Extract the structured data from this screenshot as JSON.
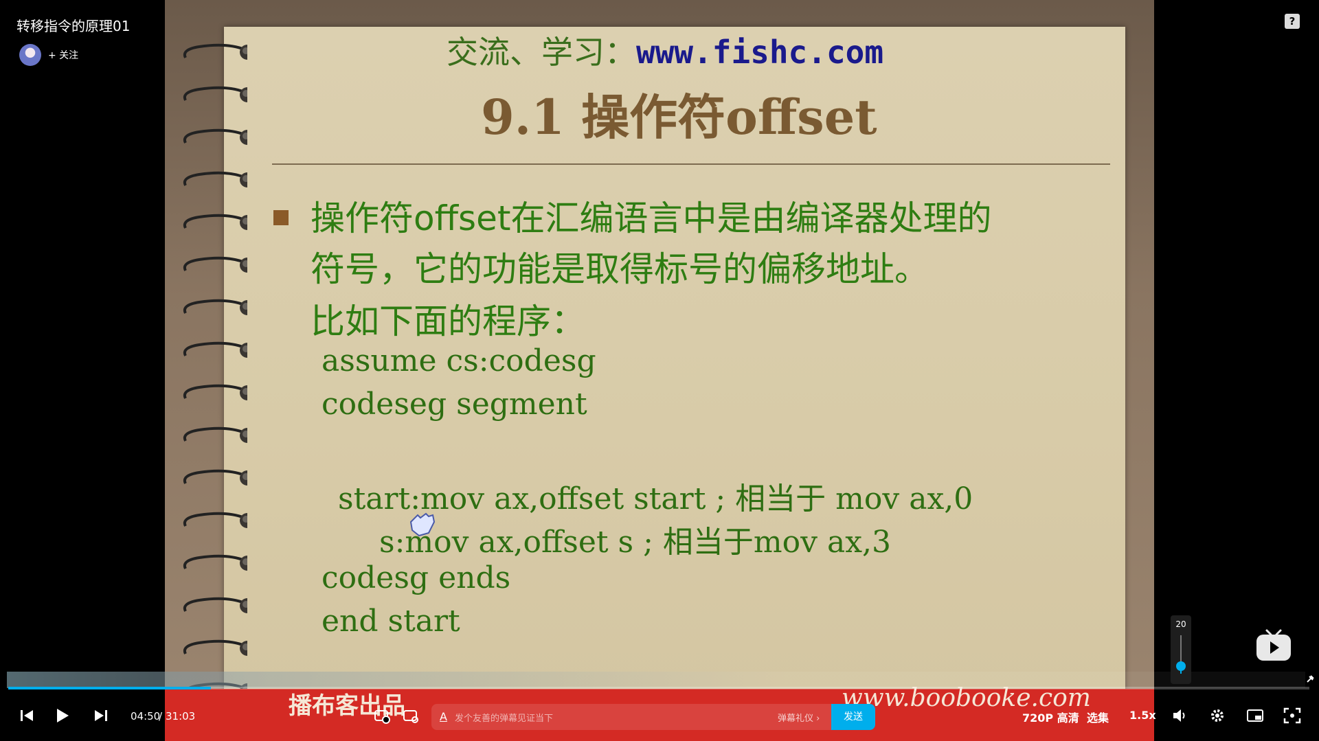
{
  "header": {
    "title": "转移指令的原理01",
    "follow_label": "+ 关注",
    "help_icon": "?"
  },
  "slide": {
    "site_prefix": "交流、学习：",
    "site_url": "www.fishc.com",
    "title": "9.1 操作符offset",
    "lines": [
      "操作符offset在汇编语言中是由编译器处理的",
      "符号，它的功能是取得标号的偏移地址。",
      "比如下面的程序："
    ],
    "code": [
      "assume cs:codesg",
      "codeseg segment",
      "start:mov ax,offset start ; 相当于 mov ax,0",
      "s:mov ax,offset s      ; 相当于mov ax,3",
      "codesg ends",
      "end start"
    ],
    "banner_brand": "播布客出品",
    "banner_url": "www.boobooke.com"
  },
  "player": {
    "time_current": "04:50",
    "time_sep": "/",
    "time_total": "31:03",
    "progress_fraction": 0.156,
    "volume_value": "20",
    "volume_fraction": 0.2,
    "danmaku_placeholder": "发个友善的弹幕见证当下",
    "danmaku_etiquette": "弹幕礼仪 ›",
    "send_label": "发送",
    "quality_label": "720P 高清",
    "episodes_label": "选集",
    "speed_label": "1.5x",
    "accent_color": "#00aeec"
  }
}
